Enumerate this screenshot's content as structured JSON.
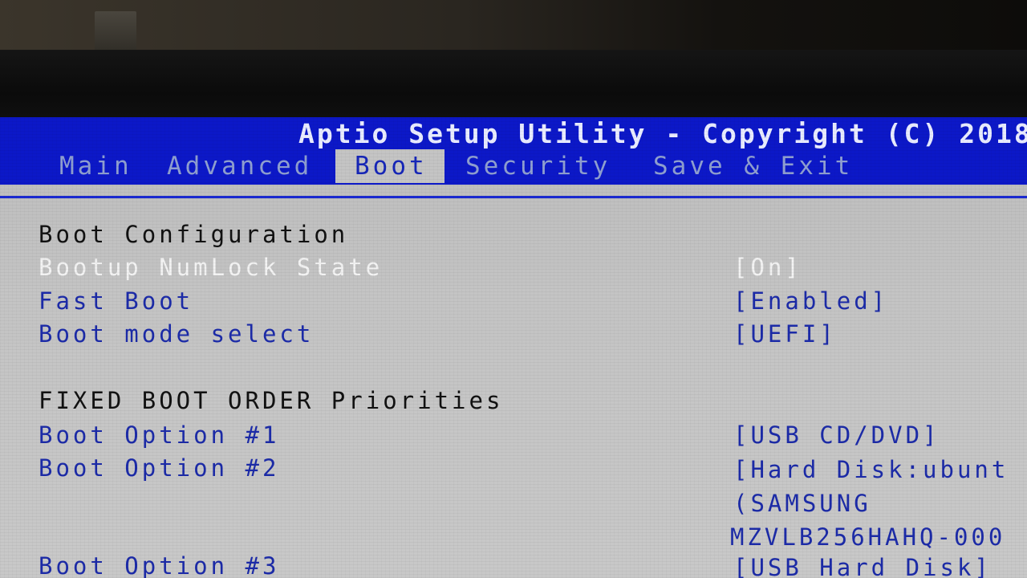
{
  "header": {
    "title": "Aptio Setup Utility - Copyright (C) 2018"
  },
  "tabs": [
    {
      "label": "Main"
    },
    {
      "label": "Advanced"
    },
    {
      "label": "Boot"
    },
    {
      "label": "Security"
    },
    {
      "label": "Save & Exit"
    }
  ],
  "active_tab": "Boot",
  "boot_configuration": {
    "heading": "Boot Configuration",
    "items": [
      {
        "label": "Bootup NumLock State",
        "value": "[On]"
      },
      {
        "label": "Fast Boot",
        "value": "[Enabled]"
      },
      {
        "label": "Boot mode select",
        "value": "[UEFI]"
      }
    ]
  },
  "fixed_boot_order": {
    "heading": "FIXED BOOT ORDER Priorities",
    "items": [
      {
        "label": "Boot Option #1",
        "value": "[USB CD/DVD]"
      },
      {
        "label": "Boot Option #2",
        "value_lines": [
          "[Hard Disk:ubunt",
          "(SAMSUNG",
          "MZVLB256HAHQ-000"
        ]
      },
      {
        "label": "Boot Option #3",
        "value": "[USB Hard Disk]"
      }
    ]
  },
  "colors": {
    "header_blue": "#0c18c8",
    "panel_gray": "#c4c4c4",
    "option_blue": "#1c2ba8",
    "highlight_white": "#f3f3f3"
  }
}
